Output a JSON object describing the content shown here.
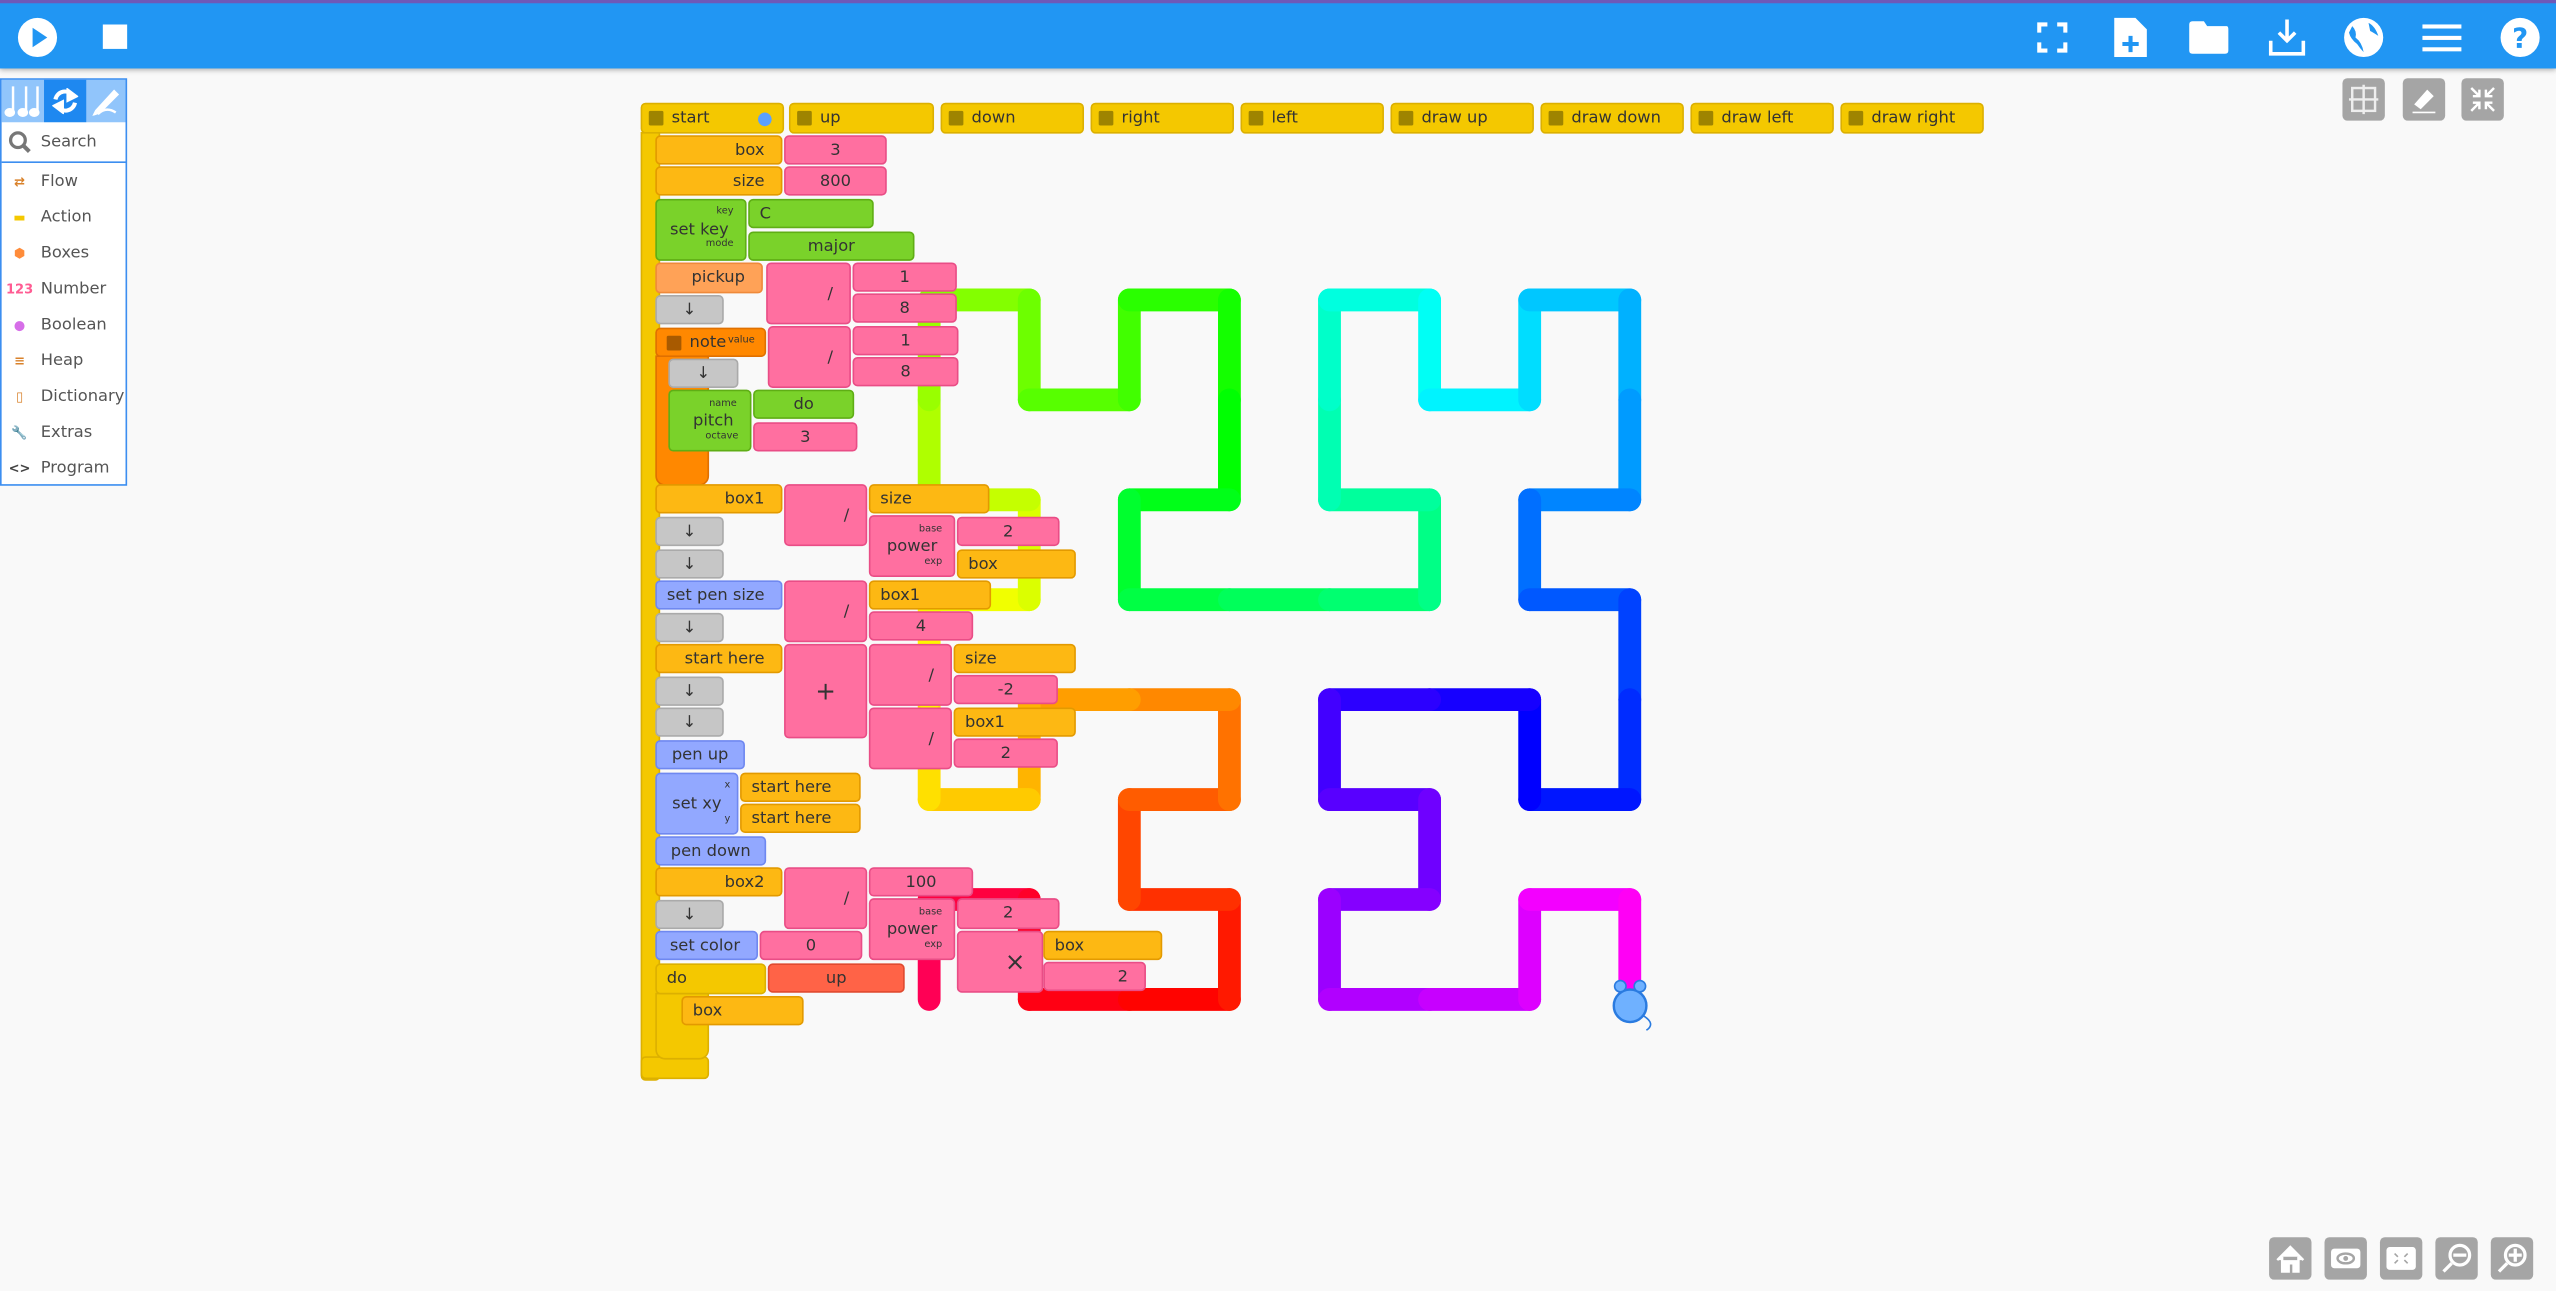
{
  "toolbar": {
    "left": [
      {
        "icon": "play-icon"
      },
      {
        "icon": "stop-icon"
      }
    ],
    "right": [
      {
        "icon": "fullscreen-icon"
      },
      {
        "icon": "new-file-icon"
      },
      {
        "icon": "open-folder-icon"
      },
      {
        "icon": "download-icon"
      },
      {
        "icon": "language-globe-icon"
      },
      {
        "icon": "menu-icon"
      },
      {
        "icon": "help-icon"
      }
    ],
    "color": "#2196f3"
  },
  "palette": {
    "tabs": [
      {
        "icon": "music-notes-icon"
      },
      {
        "icon": "flow-refresh-icon",
        "selected": true
      },
      {
        "icon": "art-pen-icon"
      }
    ],
    "search_label": "Search",
    "items": [
      {
        "label": "Flow",
        "icon": "flow-icon",
        "color": "#d9822b"
      },
      {
        "label": "Action",
        "icon": "action-icon",
        "color": "#f4c800"
      },
      {
        "label": "Boxes",
        "icon": "boxes-icon",
        "color": "#ff8c3a"
      },
      {
        "label": "Number",
        "icon": "number-icon",
        "color": "#ff5c93"
      },
      {
        "label": "Boolean",
        "icon": "boolean-icon",
        "color": "#d66ee8"
      },
      {
        "label": "Heap",
        "icon": "heap-icon",
        "color": "#d9822b"
      },
      {
        "label": "Dictionary",
        "icon": "dictionary-icon",
        "color": "#d9822b"
      },
      {
        "label": "Extras",
        "icon": "wrench-icon",
        "color": "#999999"
      },
      {
        "label": "Program",
        "icon": "code-icon",
        "color": "#444444"
      }
    ]
  },
  "hats": [
    "start",
    "up",
    "down",
    "right",
    "left",
    "draw up",
    "draw down",
    "draw left",
    "draw right"
  ],
  "program_blocks": [
    "box",
    "3",
    "size",
    "800",
    "set key",
    "key",
    "mode",
    "C",
    "major",
    "pickup",
    "/",
    "1",
    "8",
    "↓",
    "note",
    "value",
    "/",
    "1",
    "8",
    "↓",
    "pitch",
    "name",
    "octave",
    "do",
    "3",
    "box1",
    "/",
    "size",
    "power",
    "base",
    "exp",
    "2",
    "box",
    "↓",
    "↓",
    "set pen size",
    "/",
    "box1",
    "4",
    "↓",
    "start here",
    "+",
    "/",
    "size",
    "-2",
    "/",
    "box1",
    "2",
    "↓",
    "↓",
    "pen up",
    "set xy",
    "x",
    "y",
    "start here",
    "start here",
    "pen down",
    "box2",
    "/",
    "100",
    "power",
    "base",
    "exp",
    "2",
    "×",
    "box",
    "2",
    "↓",
    "set color",
    "0",
    "do",
    "up",
    "box"
  ],
  "grid_controls": [
    {
      "icon": "grid-icon"
    },
    {
      "icon": "eraser-icon"
    },
    {
      "icon": "collapse-icon"
    }
  ],
  "bottom_controls": [
    {
      "icon": "home-icon"
    },
    {
      "icon": "show-blocks-eye-icon"
    },
    {
      "icon": "expand-blocks-icon"
    },
    {
      "icon": "zoom-out-icon"
    },
    {
      "icon": "zoom-in-icon"
    }
  ],
  "drawing": {
    "shape": "Hilbert curve order 3",
    "hue_gradient": "rainbow"
  },
  "colors": {
    "action": "#f4c800",
    "boxes": "#fdb813",
    "number": "#ff6fa0",
    "pitch": "#7ad22a",
    "pen": "#92a8ff",
    "flow": "#c6c6c6"
  }
}
